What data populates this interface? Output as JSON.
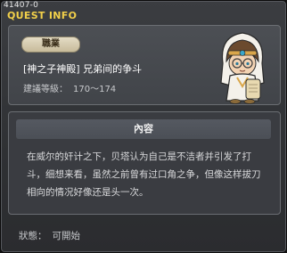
{
  "window": {
    "quest_id": "41407-0",
    "title": "QUEST INFO"
  },
  "header": {
    "job_label": "職業",
    "quest_name": "[神之子神殿] 兄弟间的争斗",
    "level_label": "建議等級：",
    "level_range": "170～174"
  },
  "content": {
    "title": "內容",
    "body": "在威尔的奸计之下，贝塔认为自己是不洁者并引发了打斗，细想来看，虽然之前曾有过口角之争，但像这样拔刀相向的情况好像还是头一次。"
  },
  "status": {
    "label": "狀態：",
    "value": "可開始"
  },
  "icons": {
    "avatar": "npc-portrait-icon"
  }
}
